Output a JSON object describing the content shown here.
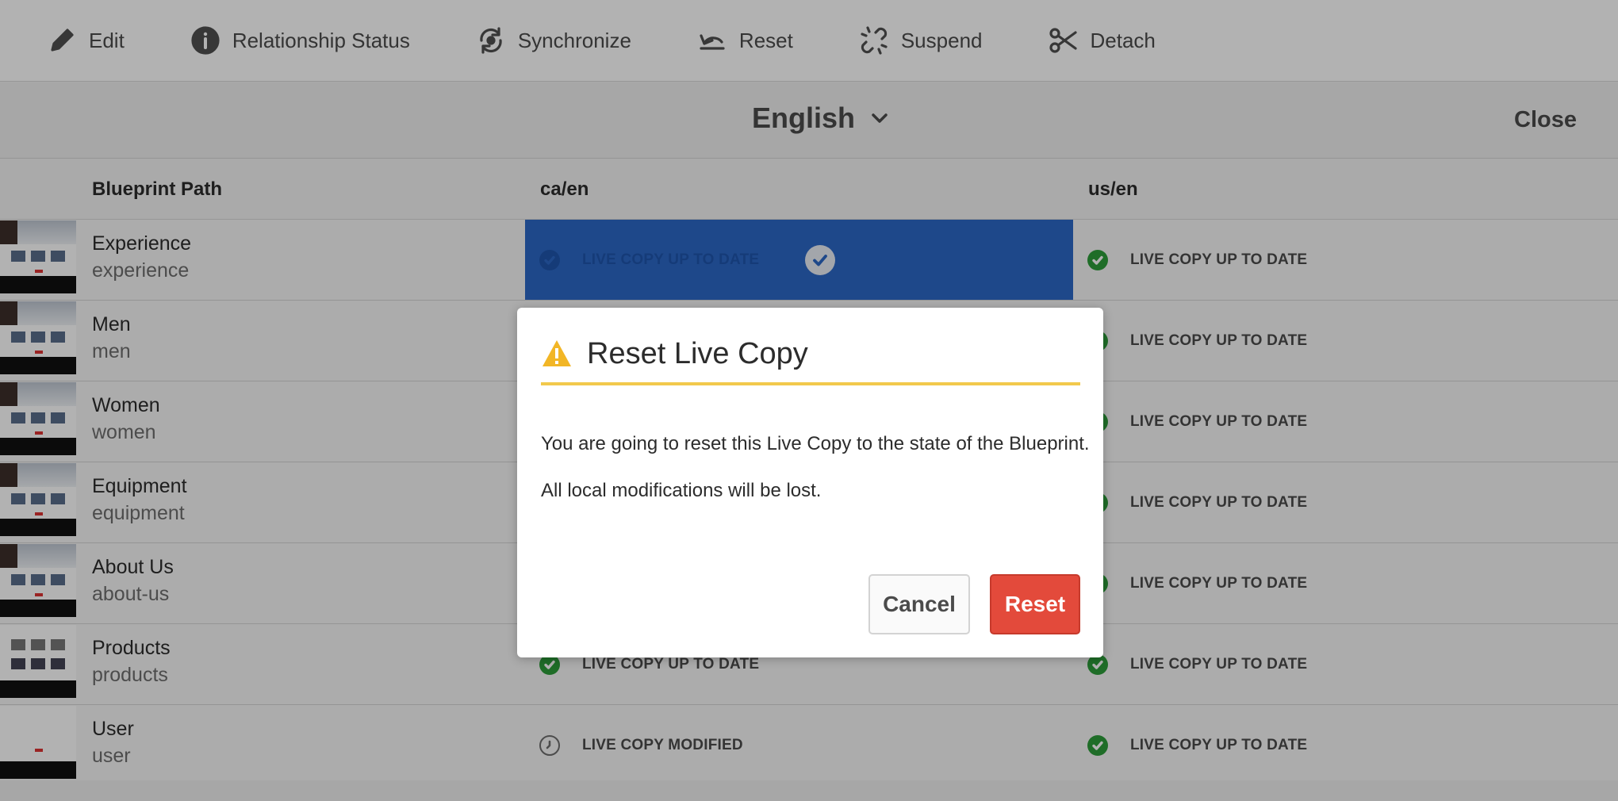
{
  "toolbar": {
    "items": [
      {
        "label": "Edit",
        "icon": "pencil-icon"
      },
      {
        "label": "Relationship Status",
        "icon": "info-icon"
      },
      {
        "label": "Synchronize",
        "icon": "sync-icon"
      },
      {
        "label": "Reset",
        "icon": "undo-icon"
      },
      {
        "label": "Suspend",
        "icon": "broken-link-icon"
      },
      {
        "label": "Detach",
        "icon": "scissors-icon"
      }
    ]
  },
  "header": {
    "language": "English",
    "close_label": "Close"
  },
  "table": {
    "columns": [
      "Blueprint Path",
      "ca/en",
      "us/en"
    ],
    "rows": [
      {
        "name": "Experience",
        "path": "experience",
        "ca": "LIVE COPY UP TO DATE",
        "us": "LIVE COPY UP TO DATE"
      },
      {
        "name": "Men",
        "path": "men",
        "ca": "",
        "us": "LIVE COPY UP TO DATE"
      },
      {
        "name": "Women",
        "path": "women",
        "ca": "",
        "us": "LIVE COPY UP TO DATE"
      },
      {
        "name": "Equipment",
        "path": "equipment",
        "ca": "",
        "us": "LIVE COPY UP TO DATE"
      },
      {
        "name": "About Us",
        "path": "about-us",
        "ca": "",
        "us": "LIVE COPY UP TO DATE"
      },
      {
        "name": "Products",
        "path": "products",
        "ca": "LIVE COPY UP TO DATE",
        "us": "LIVE COPY UP TO DATE"
      },
      {
        "name": "User",
        "path": "user",
        "ca": "LIVE COPY MODIFIED",
        "us": "LIVE COPY UP TO DATE"
      }
    ]
  },
  "dialog": {
    "title": "Reset Live Copy",
    "message": "You are going to reset this Live Copy to the state of the Blueprint.",
    "warning": "All local modifications will be lost.",
    "cancel_label": "Cancel",
    "reset_label": "Reset"
  },
  "colors": {
    "accent_blue": "#2c67c6",
    "status_green": "#2d9d3a",
    "warning_yellow": "#f2c94c",
    "destructive_red": "#e34a3b"
  }
}
